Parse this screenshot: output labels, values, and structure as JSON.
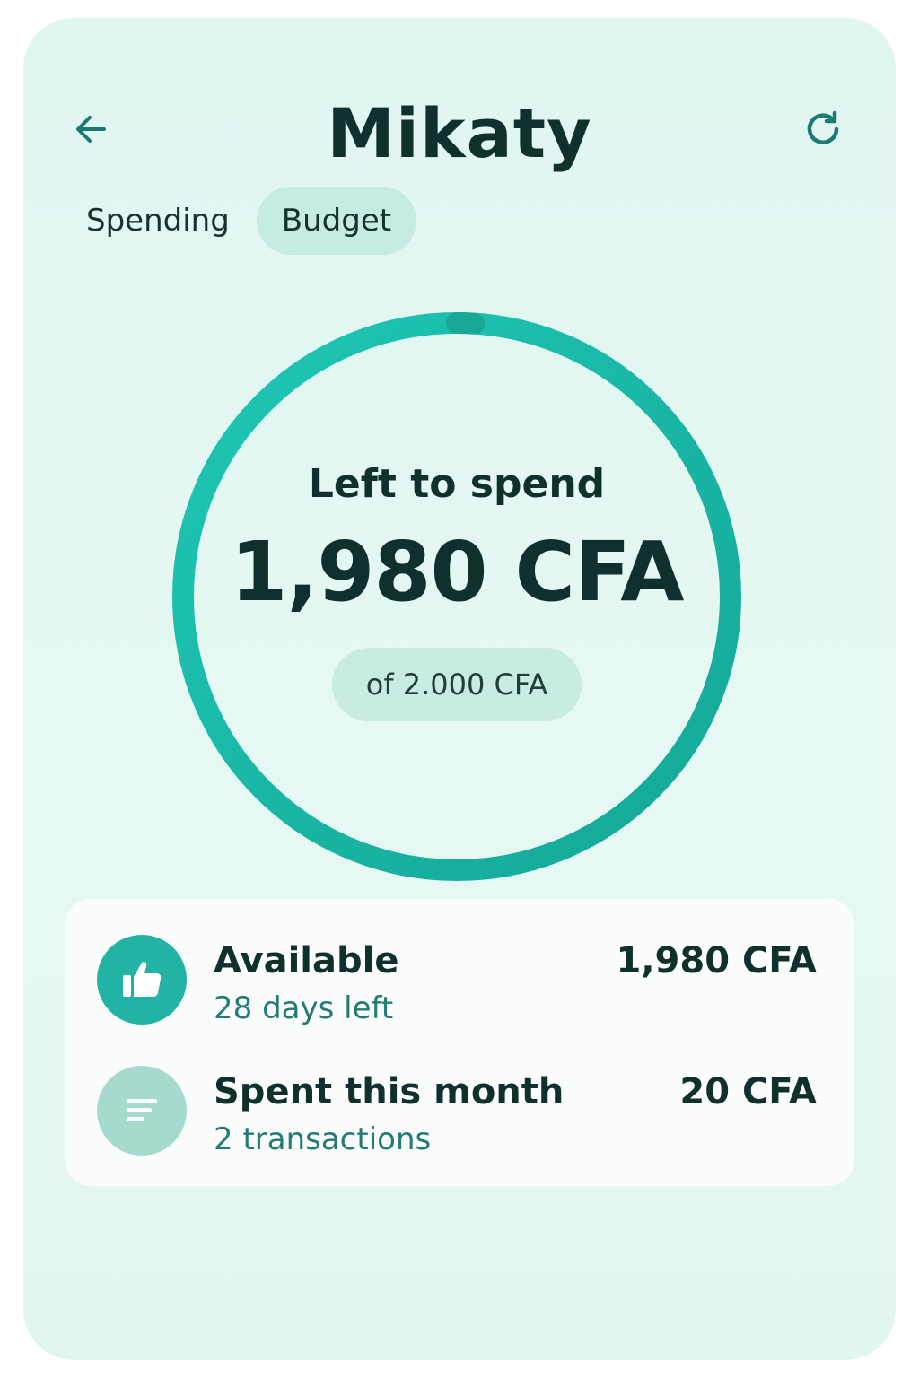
{
  "app": {
    "title": "Mikaty"
  },
  "header": {
    "back_icon": "arrow-left-icon",
    "refresh_icon": "refresh-icon"
  },
  "tabs": [
    {
      "label": "Spending",
      "active": false
    },
    {
      "label": "Budget",
      "active": true
    }
  ],
  "budget_ring": {
    "label": "Left to spend",
    "amount": "1,980 CFA",
    "total": "of 2.000 CFA",
    "remaining_fraction": 0.99
  },
  "summary": {
    "rows": [
      {
        "icon": "thumbs-up-icon",
        "title": "Available",
        "subtitle": "28 days left",
        "amount": "1,980 CFA"
      },
      {
        "icon": "list-lines-icon",
        "title": "Spent this month",
        "subtitle": "2 transactions",
        "amount": "20 CFA"
      }
    ]
  },
  "colors": {
    "accent": "#1fb8a8",
    "ring_spent": "#1aa896",
    "icon_active": "#22b3a5",
    "icon_muted": "#a6dacf",
    "text_dark": "#10302e",
    "text_sub": "#237b73"
  }
}
